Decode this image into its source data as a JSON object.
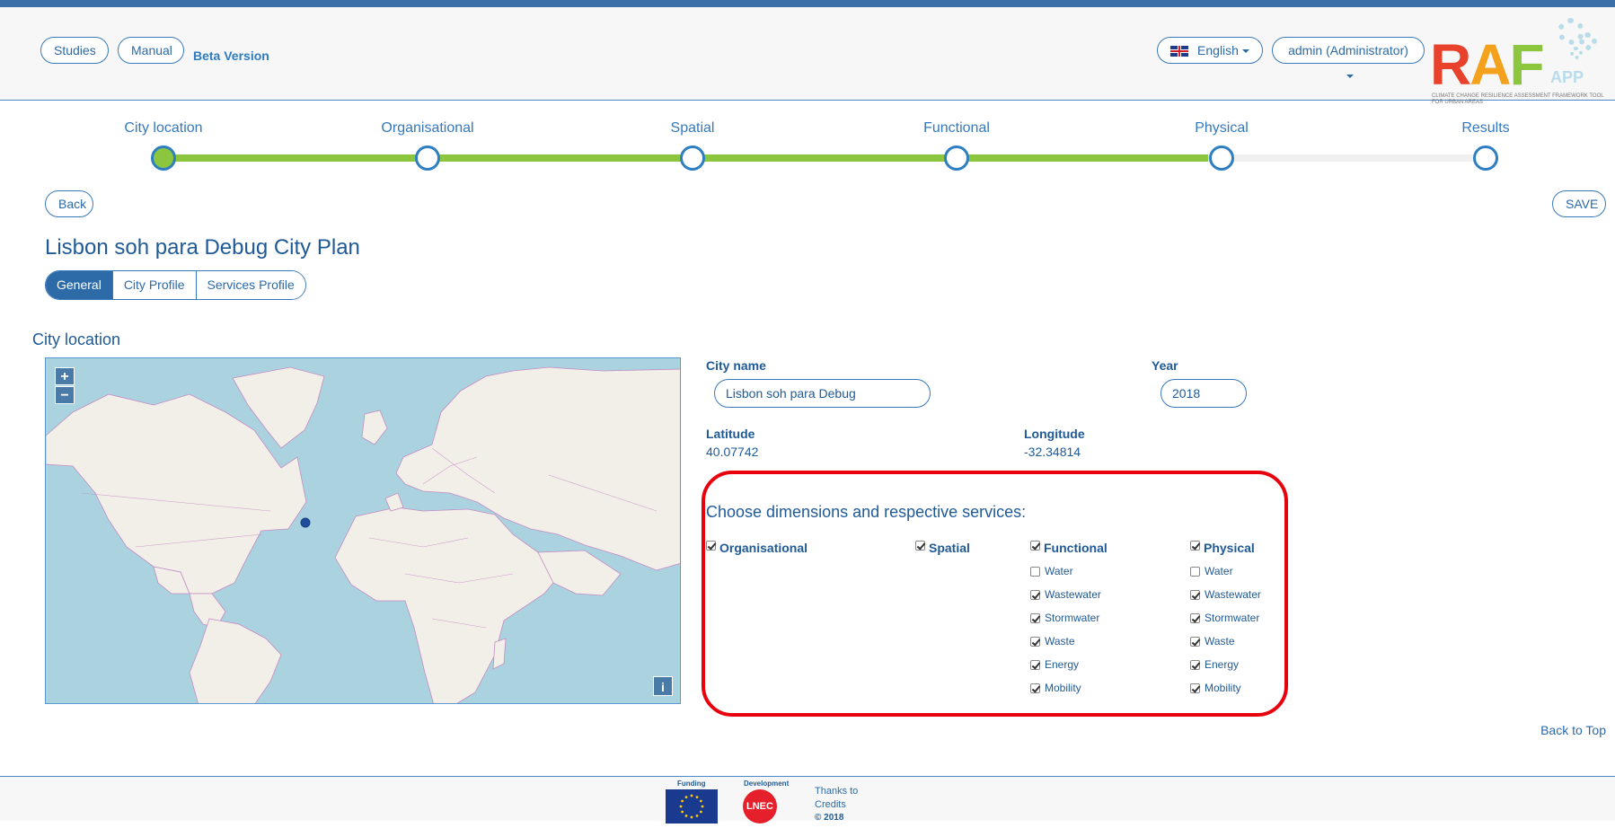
{
  "header": {
    "studies_label": "Studies",
    "manual_label": "Manual",
    "beta_label": "Beta Version",
    "language_label": "English",
    "user_label": "admin (Administrator)",
    "logo": {
      "letters_r": "R",
      "letters_a": "A",
      "letters_f": "F",
      "app": "APP",
      "subtitle": "CLIMATE CHANGE RESILIENCE ASSESSMENT FRAMEWORK TOOL FOR URBAN AREAS"
    }
  },
  "steps": {
    "items": [
      {
        "label": "City location",
        "active": true
      },
      {
        "label": "Organisational",
        "active": false
      },
      {
        "label": "Spatial",
        "active": false
      },
      {
        "label": "Functional",
        "active": false
      },
      {
        "label": "Physical",
        "active": false
      },
      {
        "label": "Results",
        "active": false
      }
    ],
    "progress_fraction": 0.79
  },
  "actions": {
    "back_label": "Back",
    "save_label": "SAVE"
  },
  "page": {
    "title": "Lisbon soh para Debug City Plan",
    "tabs": [
      "General",
      "City Profile",
      "Services Profile"
    ],
    "active_tab": "General",
    "section_title": "City location"
  },
  "map": {
    "zoom_in": "+",
    "zoom_out": "−",
    "info": "i",
    "colors": {
      "ocean": "#aad3df",
      "land": "#f2efe9",
      "border": "#c48bc4",
      "marker": "#1f4f9c"
    }
  },
  "form": {
    "city_name_label": "City name",
    "city_name_value": "Lisbon soh para Debug",
    "year_label": "Year",
    "year_value": "2018",
    "latitude_label": "Latitude",
    "latitude_value": "40.07742",
    "longitude_label": "Longitude",
    "longitude_value": "-32.34814"
  },
  "dimensions": {
    "title": "Choose dimensions and respective services:",
    "organisational": {
      "label": "Organisational",
      "checked": true
    },
    "spatial": {
      "label": "Spatial",
      "checked": true
    },
    "functional": {
      "label": "Functional",
      "checked": true,
      "services": [
        {
          "label": "Water",
          "checked": false
        },
        {
          "label": "Wastewater",
          "checked": true
        },
        {
          "label": "Stormwater",
          "checked": true
        },
        {
          "label": "Waste",
          "checked": true
        },
        {
          "label": "Energy",
          "checked": true
        },
        {
          "label": "Mobility",
          "checked": true
        }
      ]
    },
    "physical": {
      "label": "Physical",
      "checked": true,
      "services": [
        {
          "label": "Water",
          "checked": false
        },
        {
          "label": "Wastewater",
          "checked": true
        },
        {
          "label": "Stormwater",
          "checked": true
        },
        {
          "label": "Waste",
          "checked": true
        },
        {
          "label": "Energy",
          "checked": true
        },
        {
          "label": "Mobility",
          "checked": true
        }
      ]
    },
    "highlight_color": "#e8000d"
  },
  "back_to_top": "Back to Top",
  "footer": {
    "funding_label": "Funding",
    "development_label": "Development",
    "development_logo": "LNEC",
    "thanks_label": "Thanks to",
    "credits_label": "Credits",
    "copyright": "© 2018"
  }
}
